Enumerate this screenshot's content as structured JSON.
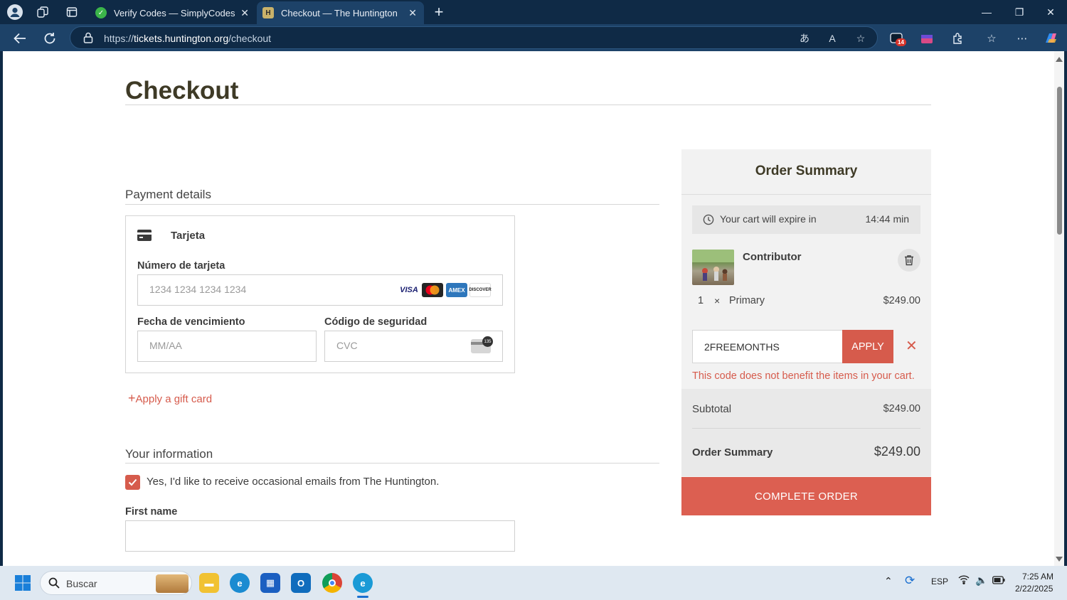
{
  "browser": {
    "tabs": [
      {
        "title": "Verify Codes — SimplyCodes",
        "active": false
      },
      {
        "title": "Checkout — The Huntington",
        "active": true
      }
    ],
    "url_scheme": "https://",
    "url_host": "tickets.huntington.org",
    "url_path": "/checkout",
    "badge_count": "14"
  },
  "page": {
    "title": "Checkout",
    "payment": {
      "heading": "Payment details",
      "method_label": "Tarjeta",
      "card_number_label": "Número de tarjeta",
      "card_number_placeholder": "1234 1234 1234 1234",
      "expiry_label": "Fecha de vencimiento",
      "expiry_placeholder": "MM/AA",
      "cvc_label": "Código de seguridad",
      "cvc_placeholder": "CVC",
      "cvc_badge": "135",
      "brands": [
        "VISA",
        "",
        "AMEX",
        "DISCOVER"
      ],
      "gift_card_link": "Apply a gift card"
    },
    "info": {
      "heading": "Your information",
      "newsletter_label": "Yes, I'd like to receive occasional emails from The Huntington.",
      "newsletter_checked": true,
      "first_name_label": "First name"
    }
  },
  "summary": {
    "title": "Order Summary",
    "expire_text": "Your cart will expire in",
    "expire_time": "14:44 min",
    "item_name": "Contributor",
    "qty": "1",
    "times": "×",
    "item_variant": "Primary",
    "item_price": "$249.00",
    "promo_code": "2FREEMONTHS",
    "apply_label": "APPLY",
    "error": "This code does not benefit the items in your cart.",
    "subtotal_label": "Subtotal",
    "subtotal_value": "$249.00",
    "total_label": "Order Summary",
    "total_value": "$249.00",
    "complete_label": "COMPLETE ORDER"
  },
  "taskbar": {
    "search_placeholder": "Buscar",
    "lang": "ESP",
    "time": "7:25 AM",
    "date": "2/22/2025"
  }
}
